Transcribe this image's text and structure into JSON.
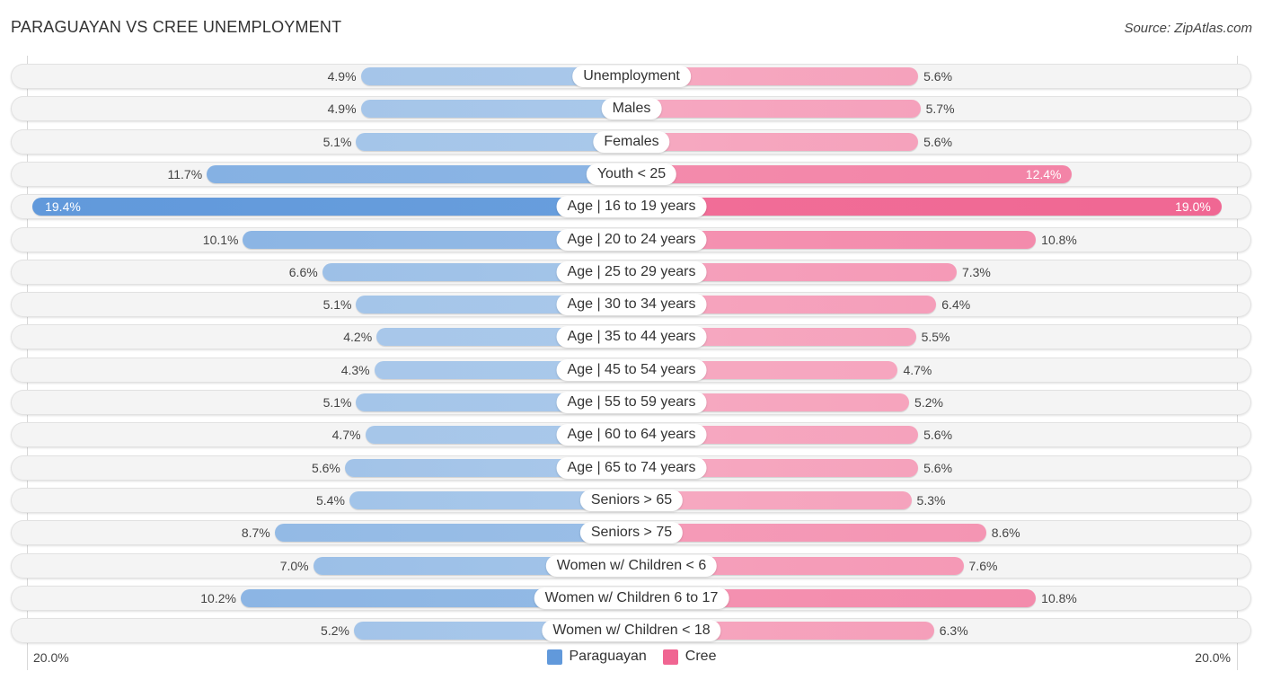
{
  "title": "PARAGUAYAN VS CREE UNEMPLOYMENT",
  "source": "Source: ZipAtlas.com",
  "colors": {
    "paraguayan_light": "#a9c8ea",
    "paraguayan_dark": "#6199db",
    "cree_light": "#f6a9c1",
    "cree_dark": "#f06592"
  },
  "chart_data": {
    "type": "bar",
    "orientation": "horizontal-diverging",
    "title": "PARAGUAYAN VS CREE UNEMPLOYMENT",
    "xlabel": "",
    "ylabel": "",
    "xlim": [
      0,
      20.0
    ],
    "axis_labels": {
      "left": "20.0%",
      "right": "20.0%"
    },
    "legend_position": "bottom-center",
    "categories": [
      "Unemployment",
      "Males",
      "Females",
      "Youth < 25",
      "Age | 16 to 19 years",
      "Age | 20 to 24 years",
      "Age | 25 to 29 years",
      "Age | 30 to 34 years",
      "Age | 35 to 44 years",
      "Age | 45 to 54 years",
      "Age | 55 to 59 years",
      "Age | 60 to 64 years",
      "Age | 65 to 74 years",
      "Seniors > 65",
      "Seniors > 75",
      "Women w/ Children < 6",
      "Women w/ Children 6 to 17",
      "Women w/ Children < 18"
    ],
    "series": [
      {
        "name": "Paraguayan",
        "side": "left",
        "values": [
          4.9,
          4.9,
          5.1,
          11.7,
          19.4,
          10.1,
          6.6,
          5.1,
          4.2,
          4.3,
          5.1,
          4.7,
          5.6,
          5.4,
          8.7,
          7.0,
          10.2,
          5.2
        ],
        "labels": [
          "4.9%",
          "4.9%",
          "5.1%",
          "11.7%",
          "19.4%",
          "10.1%",
          "6.6%",
          "5.1%",
          "4.2%",
          "4.3%",
          "5.1%",
          "4.7%",
          "5.6%",
          "5.4%",
          "8.7%",
          "7.0%",
          "10.2%",
          "5.2%"
        ]
      },
      {
        "name": "Cree",
        "side": "right",
        "values": [
          5.6,
          5.7,
          5.6,
          12.4,
          19.0,
          10.8,
          7.3,
          6.4,
          5.5,
          4.7,
          5.2,
          5.6,
          5.6,
          5.3,
          8.6,
          7.6,
          10.8,
          6.3
        ],
        "labels": [
          "5.6%",
          "5.7%",
          "5.6%",
          "12.4%",
          "19.0%",
          "10.8%",
          "7.3%",
          "6.4%",
          "5.5%",
          "4.7%",
          "5.2%",
          "5.6%",
          "5.6%",
          "5.3%",
          "8.6%",
          "7.6%",
          "10.8%",
          "6.3%"
        ]
      }
    ]
  },
  "legend": [
    {
      "label": "Paraguayan",
      "color": "#6199db"
    },
    {
      "label": "Cree",
      "color": "#f06592"
    }
  ]
}
